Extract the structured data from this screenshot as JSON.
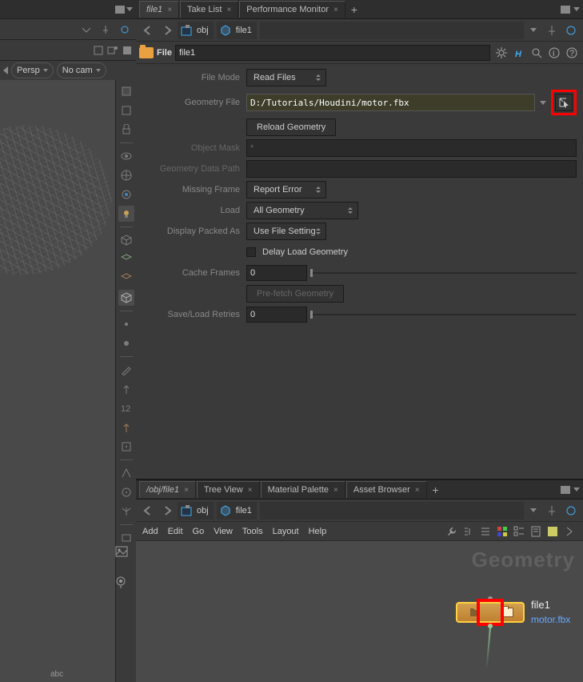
{
  "viewport": {
    "persp_label": "Persp",
    "cam_label": "No cam",
    "bottom_text": "abc"
  },
  "param_tabs": {
    "tab1": "file1",
    "tab2": "Take List",
    "tab3": "Performance Monitor"
  },
  "path": {
    "seg1": "obj",
    "seg2": "file1"
  },
  "node_header": {
    "type": "File",
    "name": "file1"
  },
  "params": {
    "file_mode": {
      "label": "File Mode",
      "value": "Read Files"
    },
    "geo_file": {
      "label": "Geometry File",
      "value": "D:/Tutorials/Houdini/motor.fbx"
    },
    "reload": {
      "label": "Reload Geometry"
    },
    "obj_mask": {
      "label": "Object Mask",
      "value": "*"
    },
    "geo_data_path": {
      "label": "Geometry Data Path",
      "value": ""
    },
    "missing_frame": {
      "label": "Missing Frame",
      "value": "Report Error"
    },
    "load": {
      "label": "Load",
      "value": "All Geometry"
    },
    "display_packed": {
      "label": "Display Packed As",
      "value": "Use File Setting"
    },
    "delay_load": {
      "label": "Delay Load Geometry"
    },
    "cache_frames": {
      "label": "Cache Frames",
      "value": "0"
    },
    "prefetch": {
      "label": "Pre-fetch Geometry"
    },
    "save_retries": {
      "label": "Save/Load Retries",
      "value": "0"
    }
  },
  "net_tabs": {
    "tab1": "/obj/file1",
    "tab2": "Tree View",
    "tab3": "Material Palette",
    "tab4": "Asset Browser"
  },
  "net_path": {
    "seg1": "obj",
    "seg2": "file1"
  },
  "net_menu": {
    "add": "Add",
    "edit": "Edit",
    "go": "Go",
    "view": "View",
    "tools": "Tools",
    "layout": "Layout",
    "help": "Help"
  },
  "network": {
    "watermark": "Geometry",
    "node_name": "file1",
    "node_file": "motor.fbx"
  }
}
